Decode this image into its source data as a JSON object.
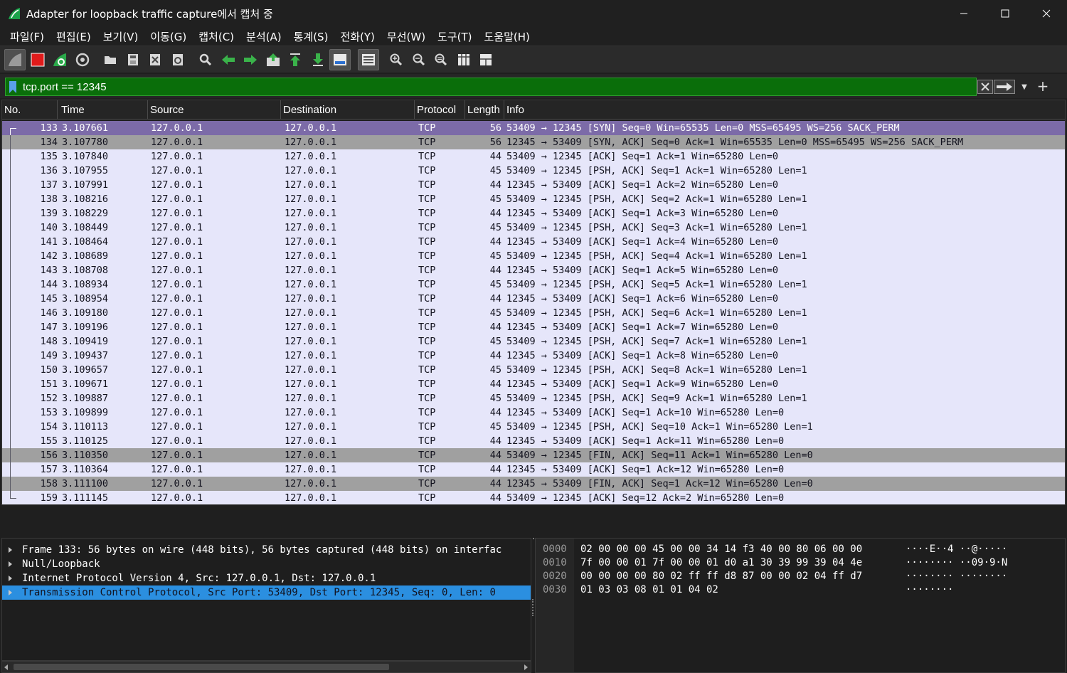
{
  "window": {
    "title": "Adapter for loopback traffic capture에서 캡처 중",
    "controls": [
      "minimize",
      "maximize",
      "close"
    ]
  },
  "menu": [
    "파일(F)",
    "편집(E)",
    "보기(V)",
    "이동(G)",
    "캡처(C)",
    "분석(A)",
    "통계(S)",
    "전화(Y)",
    "무선(W)",
    "도구(T)",
    "도움말(H)"
  ],
  "toolbar": {
    "icons": [
      "start-capture-icon",
      "stop-capture-icon",
      "restart-capture-icon",
      "capture-options-icon",
      "open-file-icon",
      "save-file-icon",
      "close-file-icon",
      "reload-file-icon",
      "find-packet-icon",
      "go-back-icon",
      "go-forward-icon",
      "go-to-packet-icon",
      "go-first-packet-icon",
      "go-last-packet-icon",
      "auto-scroll-icon",
      "colorize-icon",
      "zoom-in-icon",
      "zoom-out-icon",
      "zoom-normal-icon",
      "resize-columns-icon",
      "layout-icon"
    ]
  },
  "filter": {
    "value": "tcp.port == 12345",
    "color": "#0a6e0a"
  },
  "columns": [
    "No.",
    "Time",
    "Source",
    "Destination",
    "Protocol",
    "Length",
    "Info"
  ],
  "packets": [
    {
      "no": "133",
      "time": "3.107661",
      "src": "127.0.0.1",
      "dst": "127.0.0.1",
      "proto": "TCP",
      "len": "56",
      "info": "53409 → 12345 [SYN] Seq=0 Win=65535 Len=0 MSS=65495 WS=256 SACK_PERM",
      "style": "selected"
    },
    {
      "no": "134",
      "time": "3.107780",
      "src": "127.0.0.1",
      "dst": "127.0.0.1",
      "proto": "TCP",
      "len": "56",
      "info": "12345 → 53409 [SYN, ACK] Seq=0 Ack=1 Win=65535 Len=0 MSS=65495 WS=256 SACK_PERM",
      "style": "gray"
    },
    {
      "no": "135",
      "time": "3.107840",
      "src": "127.0.0.1",
      "dst": "127.0.0.1",
      "proto": "TCP",
      "len": "44",
      "info": "53409 → 12345 [ACK] Seq=1 Ack=1 Win=65280 Len=0",
      "style": "normal"
    },
    {
      "no": "136",
      "time": "3.107955",
      "src": "127.0.0.1",
      "dst": "127.0.0.1",
      "proto": "TCP",
      "len": "45",
      "info": "53409 → 12345 [PSH, ACK] Seq=1 Ack=1 Win=65280 Len=1",
      "style": "normal"
    },
    {
      "no": "137",
      "time": "3.107991",
      "src": "127.0.0.1",
      "dst": "127.0.0.1",
      "proto": "TCP",
      "len": "44",
      "info": "12345 → 53409 [ACK] Seq=1 Ack=2 Win=65280 Len=0",
      "style": "normal"
    },
    {
      "no": "138",
      "time": "3.108216",
      "src": "127.0.0.1",
      "dst": "127.0.0.1",
      "proto": "TCP",
      "len": "45",
      "info": "53409 → 12345 [PSH, ACK] Seq=2 Ack=1 Win=65280 Len=1",
      "style": "normal"
    },
    {
      "no": "139",
      "time": "3.108229",
      "src": "127.0.0.1",
      "dst": "127.0.0.1",
      "proto": "TCP",
      "len": "44",
      "info": "12345 → 53409 [ACK] Seq=1 Ack=3 Win=65280 Len=0",
      "style": "normal"
    },
    {
      "no": "140",
      "time": "3.108449",
      "src": "127.0.0.1",
      "dst": "127.0.0.1",
      "proto": "TCP",
      "len": "45",
      "info": "53409 → 12345 [PSH, ACK] Seq=3 Ack=1 Win=65280 Len=1",
      "style": "normal"
    },
    {
      "no": "141",
      "time": "3.108464",
      "src": "127.0.0.1",
      "dst": "127.0.0.1",
      "proto": "TCP",
      "len": "44",
      "info": "12345 → 53409 [ACK] Seq=1 Ack=4 Win=65280 Len=0",
      "style": "normal"
    },
    {
      "no": "142",
      "time": "3.108689",
      "src": "127.0.0.1",
      "dst": "127.0.0.1",
      "proto": "TCP",
      "len": "45",
      "info": "53409 → 12345 [PSH, ACK] Seq=4 Ack=1 Win=65280 Len=1",
      "style": "normal"
    },
    {
      "no": "143",
      "time": "3.108708",
      "src": "127.0.0.1",
      "dst": "127.0.0.1",
      "proto": "TCP",
      "len": "44",
      "info": "12345 → 53409 [ACK] Seq=1 Ack=5 Win=65280 Len=0",
      "style": "normal"
    },
    {
      "no": "144",
      "time": "3.108934",
      "src": "127.0.0.1",
      "dst": "127.0.0.1",
      "proto": "TCP",
      "len": "45",
      "info": "53409 → 12345 [PSH, ACK] Seq=5 Ack=1 Win=65280 Len=1",
      "style": "normal"
    },
    {
      "no": "145",
      "time": "3.108954",
      "src": "127.0.0.1",
      "dst": "127.0.0.1",
      "proto": "TCP",
      "len": "44",
      "info": "12345 → 53409 [ACK] Seq=1 Ack=6 Win=65280 Len=0",
      "style": "normal"
    },
    {
      "no": "146",
      "time": "3.109180",
      "src": "127.0.0.1",
      "dst": "127.0.0.1",
      "proto": "TCP",
      "len": "45",
      "info": "53409 → 12345 [PSH, ACK] Seq=6 Ack=1 Win=65280 Len=1",
      "style": "normal"
    },
    {
      "no": "147",
      "time": "3.109196",
      "src": "127.0.0.1",
      "dst": "127.0.0.1",
      "proto": "TCP",
      "len": "44",
      "info": "12345 → 53409 [ACK] Seq=1 Ack=7 Win=65280 Len=0",
      "style": "normal"
    },
    {
      "no": "148",
      "time": "3.109419",
      "src": "127.0.0.1",
      "dst": "127.0.0.1",
      "proto": "TCP",
      "len": "45",
      "info": "53409 → 12345 [PSH, ACK] Seq=7 Ack=1 Win=65280 Len=1",
      "style": "normal"
    },
    {
      "no": "149",
      "time": "3.109437",
      "src": "127.0.0.1",
      "dst": "127.0.0.1",
      "proto": "TCP",
      "len": "44",
      "info": "12345 → 53409 [ACK] Seq=1 Ack=8 Win=65280 Len=0",
      "style": "normal"
    },
    {
      "no": "150",
      "time": "3.109657",
      "src": "127.0.0.1",
      "dst": "127.0.0.1",
      "proto": "TCP",
      "len": "45",
      "info": "53409 → 12345 [PSH, ACK] Seq=8 Ack=1 Win=65280 Len=1",
      "style": "normal"
    },
    {
      "no": "151",
      "time": "3.109671",
      "src": "127.0.0.1",
      "dst": "127.0.0.1",
      "proto": "TCP",
      "len": "44",
      "info": "12345 → 53409 [ACK] Seq=1 Ack=9 Win=65280 Len=0",
      "style": "normal"
    },
    {
      "no": "152",
      "time": "3.109887",
      "src": "127.0.0.1",
      "dst": "127.0.0.1",
      "proto": "TCP",
      "len": "45",
      "info": "53409 → 12345 [PSH, ACK] Seq=9 Ack=1 Win=65280 Len=1",
      "style": "normal"
    },
    {
      "no": "153",
      "time": "3.109899",
      "src": "127.0.0.1",
      "dst": "127.0.0.1",
      "proto": "TCP",
      "len": "44",
      "info": "12345 → 53409 [ACK] Seq=1 Ack=10 Win=65280 Len=0",
      "style": "normal"
    },
    {
      "no": "154",
      "time": "3.110113",
      "src": "127.0.0.1",
      "dst": "127.0.0.1",
      "proto": "TCP",
      "len": "45",
      "info": "53409 → 12345 [PSH, ACK] Seq=10 Ack=1 Win=65280 Len=1",
      "style": "normal"
    },
    {
      "no": "155",
      "time": "3.110125",
      "src": "127.0.0.1",
      "dst": "127.0.0.1",
      "proto": "TCP",
      "len": "44",
      "info": "12345 → 53409 [ACK] Seq=1 Ack=11 Win=65280 Len=0",
      "style": "normal"
    },
    {
      "no": "156",
      "time": "3.110350",
      "src": "127.0.0.1",
      "dst": "127.0.0.1",
      "proto": "TCP",
      "len": "44",
      "info": "53409 → 12345 [FIN, ACK] Seq=11 Ack=1 Win=65280 Len=0",
      "style": "gray"
    },
    {
      "no": "157",
      "time": "3.110364",
      "src": "127.0.0.1",
      "dst": "127.0.0.1",
      "proto": "TCP",
      "len": "44",
      "info": "12345 → 53409 [ACK] Seq=1 Ack=12 Win=65280 Len=0",
      "style": "normal"
    },
    {
      "no": "158",
      "time": "3.111100",
      "src": "127.0.0.1",
      "dst": "127.0.0.1",
      "proto": "TCP",
      "len": "44",
      "info": "12345 → 53409 [FIN, ACK] Seq=1 Ack=12 Win=65280 Len=0",
      "style": "gray"
    },
    {
      "no": "159",
      "time": "3.111145",
      "src": "127.0.0.1",
      "dst": "127.0.0.1",
      "proto": "TCP",
      "len": "44",
      "info": "53409 → 12345 [ACK] Seq=12 Ack=2 Win=65280 Len=0",
      "style": "normal"
    }
  ],
  "details": [
    {
      "text": "Frame 133: 56 bytes on wire (448 bits), 56 bytes captured (448 bits) on interfac",
      "selected": false
    },
    {
      "text": "Null/Loopback",
      "selected": false
    },
    {
      "text": "Internet Protocol Version 4, Src: 127.0.0.1, Dst: 127.0.0.1",
      "selected": false
    },
    {
      "text": "Transmission Control Protocol, Src Port: 53409, Dst Port: 12345, Seq: 0, Len: 0",
      "selected": true
    }
  ],
  "bytes": [
    {
      "offset": "0000",
      "hex": "02 00 00 00 45 00 00 34  14 f3 40 00 80 06 00 00",
      "ascii": "····E··4 ··@·····"
    },
    {
      "offset": "0010",
      "hex": "7f 00 00 01 7f 00 00 01  d0 a1 30 39 99 39 04 4e",
      "ascii": "········ ··09·9·N"
    },
    {
      "offset": "0020",
      "hex": "00 00 00 00 80 02 ff ff  d8 87 00 00 02 04 ff d7",
      "ascii": "········ ········"
    },
    {
      "offset": "0030",
      "hex": "01 03 03 08 01 01 04 02",
      "ascii": "········"
    }
  ]
}
